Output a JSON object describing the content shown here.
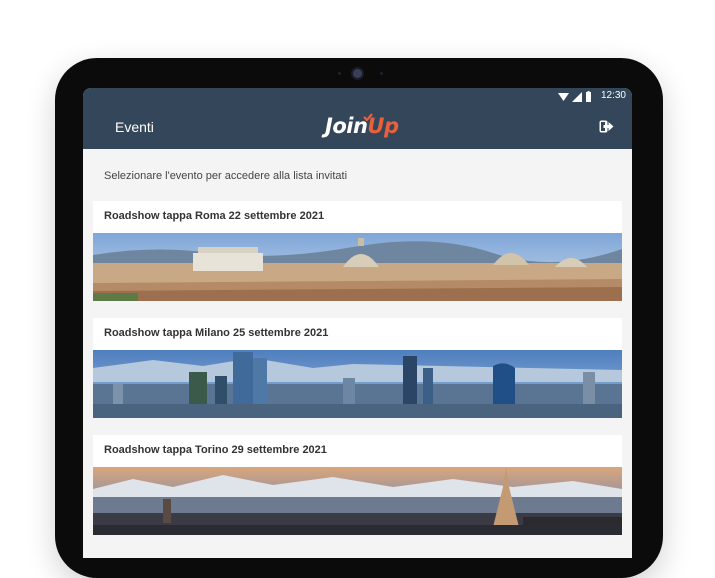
{
  "statusbar": {
    "time": "12:30"
  },
  "appbar": {
    "title": "Eventi",
    "logo_part1": "Join",
    "logo_part2": "Up",
    "logout_icon": "logout-icon"
  },
  "main": {
    "subtitle": "Selezionare l'evento per accedere alla lista invitati",
    "events": [
      {
        "title": "Roadshow tappa Roma 22 settembre 2021",
        "image": "rome-skyline"
      },
      {
        "title": "Roadshow tappa Milano 25 settembre 2021",
        "image": "milan-skyline"
      },
      {
        "title": "Roadshow tappa Torino 29 settembre 2021",
        "image": "turin-skyline"
      }
    ]
  },
  "colors": {
    "appbar": "#34475a",
    "accent": "#e8603c",
    "background": "#f4f4f4"
  }
}
